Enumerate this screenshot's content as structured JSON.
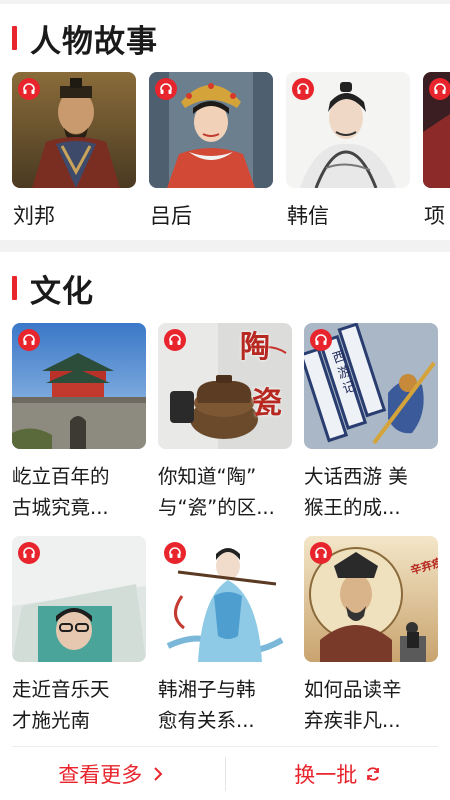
{
  "sections": {
    "people": {
      "title": "人物故事",
      "items": [
        {
          "name": "刘邦"
        },
        {
          "name": "吕后"
        },
        {
          "name": "韩信"
        },
        {
          "name": "项"
        }
      ]
    },
    "culture": {
      "title": "文化",
      "items": [
        {
          "line1": "屹立百年的",
          "line2": "古城究竟..."
        },
        {
          "line1": "你知道“陶”",
          "line2": "与“瓷”的区..."
        },
        {
          "line1": "大话西游 美",
          "line2": "猴王的成..."
        },
        {
          "line1": "走近音乐天",
          "line2": "才施光南"
        },
        {
          "line1": "韩湘子与韩",
          "line2": "愈有关系..."
        },
        {
          "line1": "如何品读辛",
          "line2": "弃疾非凡..."
        }
      ]
    }
  },
  "thumb_text": {
    "tao": "陶",
    "ci": "瓷",
    "xiyou": "西游记",
    "xinqiji": "辛弃疾"
  },
  "footer": {
    "more_label": "查看更多",
    "refresh_label": "换一批"
  },
  "colors": {
    "accent": "#e8242d",
    "text": "#1a1a1a",
    "divider": "#f2f2f2"
  },
  "icons": {
    "badge": "headphones-icon",
    "more": "chevron-right-icon",
    "refresh": "refresh-icon"
  }
}
